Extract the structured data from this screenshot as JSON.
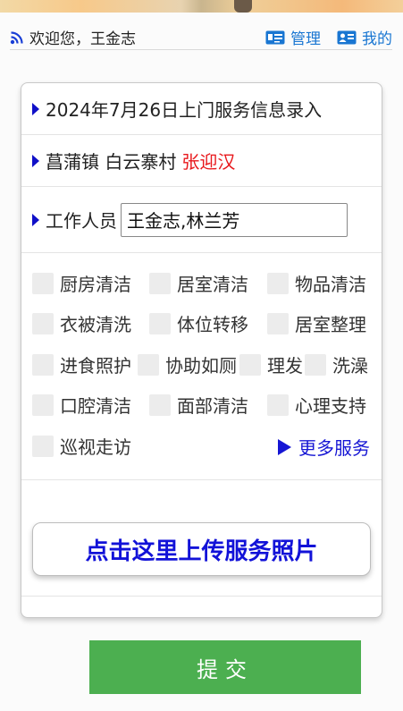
{
  "header": {
    "welcome": "欢迎您，王金志",
    "manage_label": "管理",
    "mine_label": "我的",
    "link_color": "#1976d2"
  },
  "form": {
    "title": "2024年7月26日上门服务信息录入",
    "location": "菖蒲镇 白云寨村",
    "client_name": "张迎汉",
    "worker_label": "工作人员",
    "worker_value": "王金志,林兰芳",
    "services": [
      {
        "label": "厨房清洁",
        "checked": false
      },
      {
        "label": "居室清洁",
        "checked": false
      },
      {
        "label": "物品清洁",
        "checked": false
      },
      {
        "label": "衣被清洗",
        "checked": false
      },
      {
        "label": "体位转移",
        "checked": false
      },
      {
        "label": "居室整理",
        "checked": false
      },
      {
        "label": "进食照护",
        "checked": false
      },
      {
        "label": "协助如厕",
        "checked": false
      },
      {
        "label": "理发",
        "checked": false
      },
      {
        "label": "洗澡",
        "checked": false
      },
      {
        "label": "口腔清洁",
        "checked": false
      },
      {
        "label": "面部清洁",
        "checked": false
      },
      {
        "label": "心理支持",
        "checked": false
      },
      {
        "label": "巡视走访",
        "checked": false
      }
    ],
    "more_label": "更多服务",
    "upload_label": "点击这里上传服务照片",
    "submit_label": "提交"
  },
  "colors": {
    "accent_blue": "#1616d4",
    "client_red": "#e8171b",
    "submit_green": "#4caf50"
  },
  "icons": [
    "rss-icon",
    "id-card-icon",
    "contact-card-icon",
    "caret-right-icon",
    "play-icon"
  ]
}
